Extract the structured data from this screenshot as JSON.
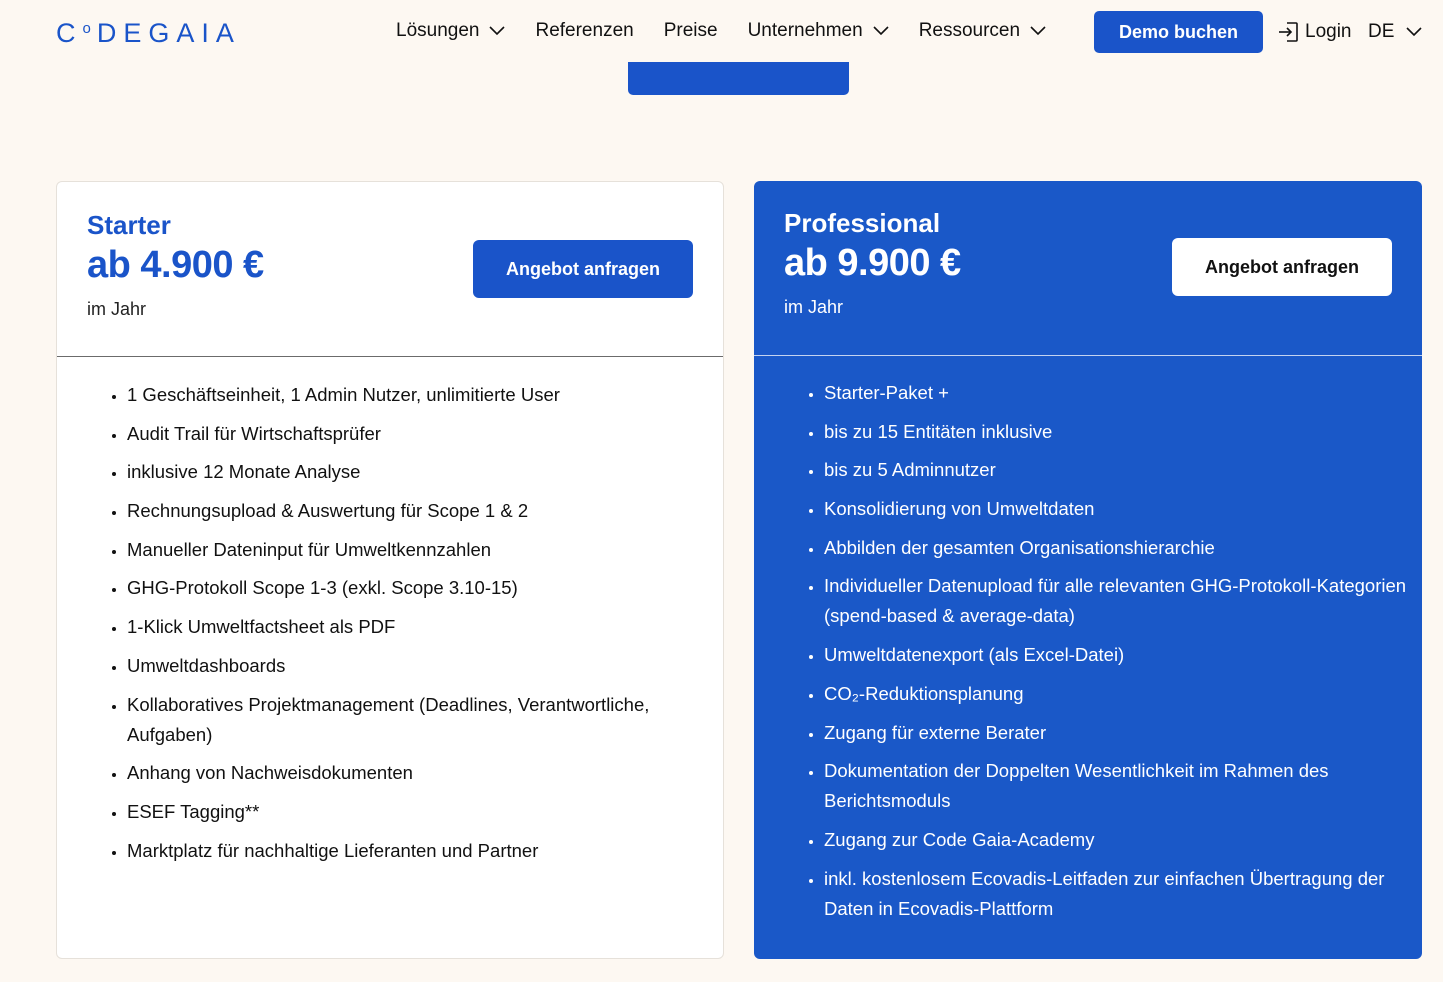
{
  "brand": {
    "logo_text_pre": "C",
    "logo_text_small": "o",
    "logo_text_post": "DEGAIA",
    "color": "#1a54c9"
  },
  "nav": {
    "items": [
      {
        "label": "Lösungen",
        "has_dropdown": true
      },
      {
        "label": "Referenzen",
        "has_dropdown": false
      },
      {
        "label": "Preise",
        "has_dropdown": false
      },
      {
        "label": "Unternehmen",
        "has_dropdown": true
      },
      {
        "label": "Ressourcen",
        "has_dropdown": true
      }
    ],
    "demo_label": "Demo buchen",
    "login_label": "Login",
    "lang_label": "DE"
  },
  "plans": {
    "starter": {
      "name": "Starter",
      "price": "ab 4.900 €",
      "period": "im Jahr",
      "cta": "Angebot anfragen",
      "features": [
        "1 Geschäftseinheit, 1 Admin Nutzer, unlimitierte User",
        "Audit Trail für Wirtschaftsprüfer",
        "inklusive 12 Monate Analyse",
        "Rechnungsupload & Auswertung für Scope 1 & 2",
        "Manueller Dateninput für Umweltkennzahlen",
        "GHG-Protokoll Scope 1-3 (exkl. Scope 3.10-15)",
        "1-Klick Umweltfactsheet als PDF",
        "Umweltdashboards",
        "Kollaboratives Projektmanagement (Deadlines, Verantwortliche, Aufgaben)",
        "Anhang von Nachweisdokumenten",
        "ESEF Tagging**",
        "Marktplatz für nachhaltige Lieferanten und Partner"
      ]
    },
    "professional": {
      "name": "Professional",
      "price": "ab 9.900 €",
      "period": "im Jahr",
      "cta": "Angebot anfragen",
      "features": [
        "Starter-Paket +",
        "bis zu 15 Entitäten inklusive",
        "bis zu 5 Adminnutzer",
        "Konsolidierung von Umweltdaten",
        "Abbilden der gesamten Organisationshierarchie",
        "Individueller Datenupload für alle relevanten GHG-Protokoll-Kategorien (spend-based & average-data)",
        "Umweltdatenexport (als Excel-Datei)",
        "CO₂-Reduktionsplanung",
        "Zugang für externe Berater",
        "Dokumentation der Doppelten Wesentlichkeit im Rahmen des Berichtsmoduls",
        "Zugang zur Code Gaia-Academy",
        "inkl. kostenlosem Ecovadis-Leitfaden zur einfachen Übertragung der Daten in Ecovadis-Plattform"
      ]
    }
  },
  "colors": {
    "background": "#fdf8f2",
    "primary": "#1a54c9",
    "pro_card": "#1a58c8"
  },
  "icons": {
    "login": "login-icon",
    "dropdown": "chevron-down-icon"
  }
}
